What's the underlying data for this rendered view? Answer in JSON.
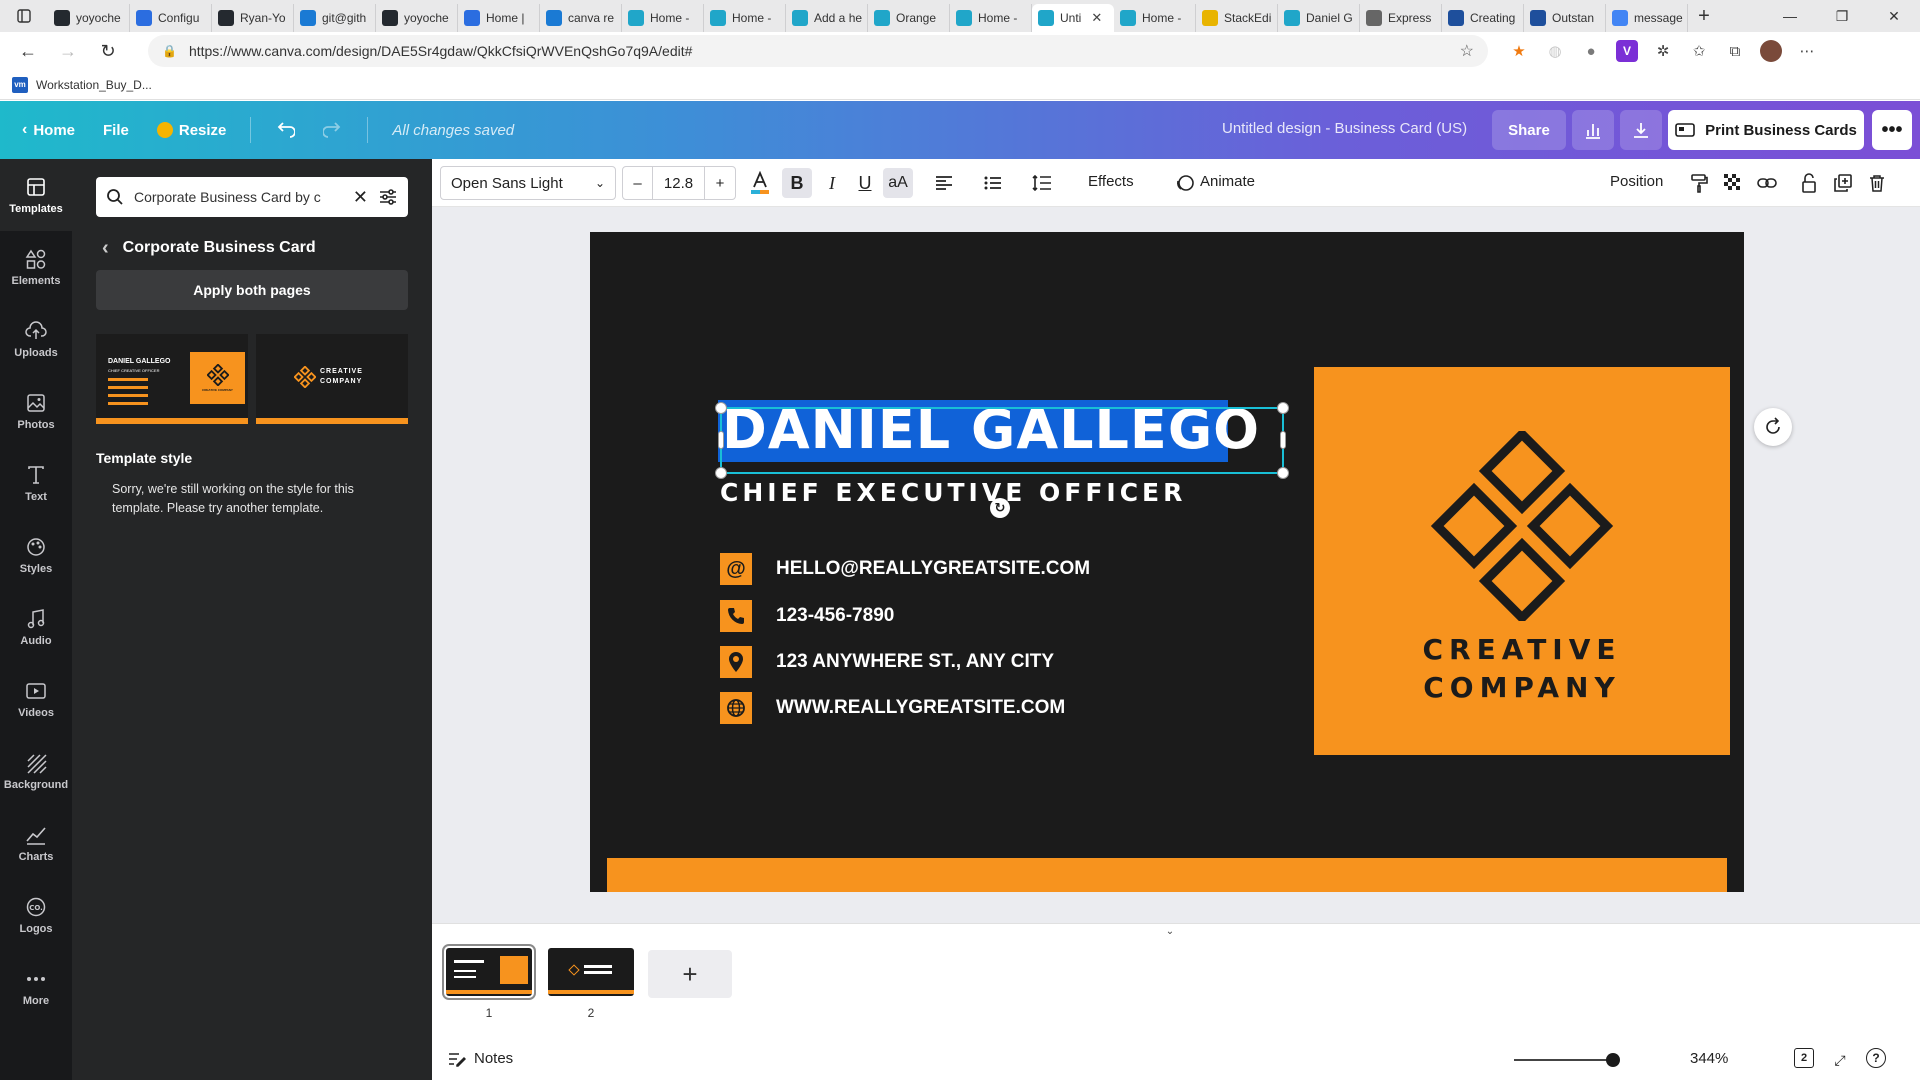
{
  "browser": {
    "tabs": [
      {
        "title": "yoyoche",
        "icon": "github-icon",
        "color": "#24292f"
      },
      {
        "title": "Configu",
        "icon": "jtd-icon",
        "color": "#2b6de0"
      },
      {
        "title": "Ryan-Yo",
        "icon": "github-icon",
        "color": "#24292f"
      },
      {
        "title": "git@gith",
        "icon": "bing-icon",
        "color": "#1a7ad4"
      },
      {
        "title": "yoyoche",
        "icon": "github-icon",
        "color": "#24292f"
      },
      {
        "title": "Home |",
        "icon": "jtd-icon",
        "color": "#2b6de0"
      },
      {
        "title": "canva re",
        "icon": "bing-icon",
        "color": "#1a7ad4"
      },
      {
        "title": "Home -",
        "icon": "canva-icon",
        "color": "#20a6c9"
      },
      {
        "title": "Home -",
        "icon": "canva-icon",
        "color": "#20a6c9"
      },
      {
        "title": "Add a he",
        "icon": "canva-icon",
        "color": "#20a6c9"
      },
      {
        "title": "Orange",
        "icon": "canva-icon",
        "color": "#20a6c9"
      },
      {
        "title": "Home -",
        "icon": "canva-icon",
        "color": "#20a6c9"
      },
      {
        "title": "Unti",
        "icon": "canva-icon",
        "color": "#20a6c9",
        "active": true
      },
      {
        "title": "Home -",
        "icon": "canva-icon",
        "color": "#20a6c9"
      },
      {
        "title": "StackEdi",
        "icon": "stackedit-icon",
        "color": "#e8b400"
      },
      {
        "title": "Daniel G",
        "icon": "canva-icon",
        "color": "#20a6c9"
      },
      {
        "title": "Express",
        "icon": "page-icon",
        "color": "#666666"
      },
      {
        "title": "Creating",
        "icon": "dotnet-icon",
        "color": "#1e4f9c"
      },
      {
        "title": "Outstan",
        "icon": "dotnet-icon",
        "color": "#1e4f9c"
      },
      {
        "title": "message",
        "icon": "google-icon",
        "color": "#4285f4"
      }
    ],
    "url": "https://www.canva.com/design/DAE5Sr4gdaw/QkkCfsiQrWVEnQshGo7q9A/edit#",
    "bookmark": "Workstation_Buy_D..."
  },
  "header": {
    "home": "Home",
    "file": "File",
    "resize": "Resize",
    "saved": "All changes saved",
    "doc_title": "Untitled design - Business Card (US)",
    "share": "Share",
    "print": "Print Business Cards"
  },
  "rail": [
    {
      "label": "Templates",
      "icon": "templates-icon",
      "active": true
    },
    {
      "label": "Elements",
      "icon": "elements-icon"
    },
    {
      "label": "Uploads",
      "icon": "uploads-icon"
    },
    {
      "label": "Photos",
      "icon": "photos-icon"
    },
    {
      "label": "Text",
      "icon": "text-icon"
    },
    {
      "label": "Styles",
      "icon": "styles-icon"
    },
    {
      "label": "Audio",
      "icon": "audio-icon"
    },
    {
      "label": "Videos",
      "icon": "videos-icon"
    },
    {
      "label": "Background",
      "icon": "background-icon"
    },
    {
      "label": "Charts",
      "icon": "charts-icon"
    },
    {
      "label": "Logos",
      "icon": "logos-icon"
    },
    {
      "label": "More",
      "icon": "more-icon"
    }
  ],
  "panel": {
    "search_value": "Corporate Business Card by c",
    "back_title": "Corporate Business Card",
    "apply": "Apply both pages",
    "style_title": "Template style",
    "style_msg": "Sorry, we're still working on the style for this template. Please try another template.",
    "thumb1_name": "DANIEL GALLEGO",
    "thumb1_role": "CHIEF CREATIVE OFFICER",
    "thumb1_logo": "CREATIVE COMPANY",
    "thumb2_logo_1": "CREATIVE",
    "thumb2_logo_2": "COMPANY"
  },
  "toolbar": {
    "font": "Open Sans Light",
    "size": "12.8",
    "minus": "–",
    "plus": "+",
    "effects": "Effects",
    "animate": "Animate",
    "position": "Position"
  },
  "card": {
    "name": "DANIEL GALLEGO",
    "title": "CHIEF EXECUTIVE OFFICER",
    "email": "HELLO@REALLYGREATSITE.COM",
    "phone": "123-456-7890",
    "address": "123 ANYWHERE ST., ANY CITY",
    "website": "WWW.REALLYGREATSITE.COM",
    "company_1": "CREATIVE",
    "company_2": "COMPANY",
    "colors": {
      "accent": "#f7931e",
      "background": "#1b1b1b",
      "selection": "#1062d8"
    }
  },
  "bottom": {
    "pages": [
      "1",
      "2"
    ],
    "notes": "Notes",
    "zoom": "344%",
    "page_count": "2",
    "zoom_level_percent": 344
  }
}
